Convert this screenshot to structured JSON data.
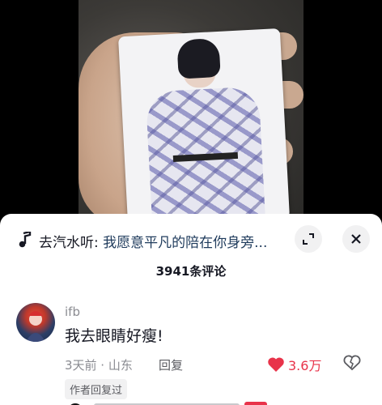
{
  "colors": {
    "accent_red": "#e8334a",
    "text_primary": "#161823",
    "text_secondary": "#8a8b91"
  },
  "music": {
    "prefix": "去汽水听:",
    "song": "我愿意平凡的陪在你身旁...",
    "icon": "music-note-icon"
  },
  "header": {
    "comment_count": "3941条评论"
  },
  "comment": {
    "username": "ifb",
    "text": "我去眼睛好瘦!",
    "meta": "3天前 · 山东",
    "reply_label": "回复",
    "like_count": "3.6万",
    "author_tag": "作者回复过"
  }
}
